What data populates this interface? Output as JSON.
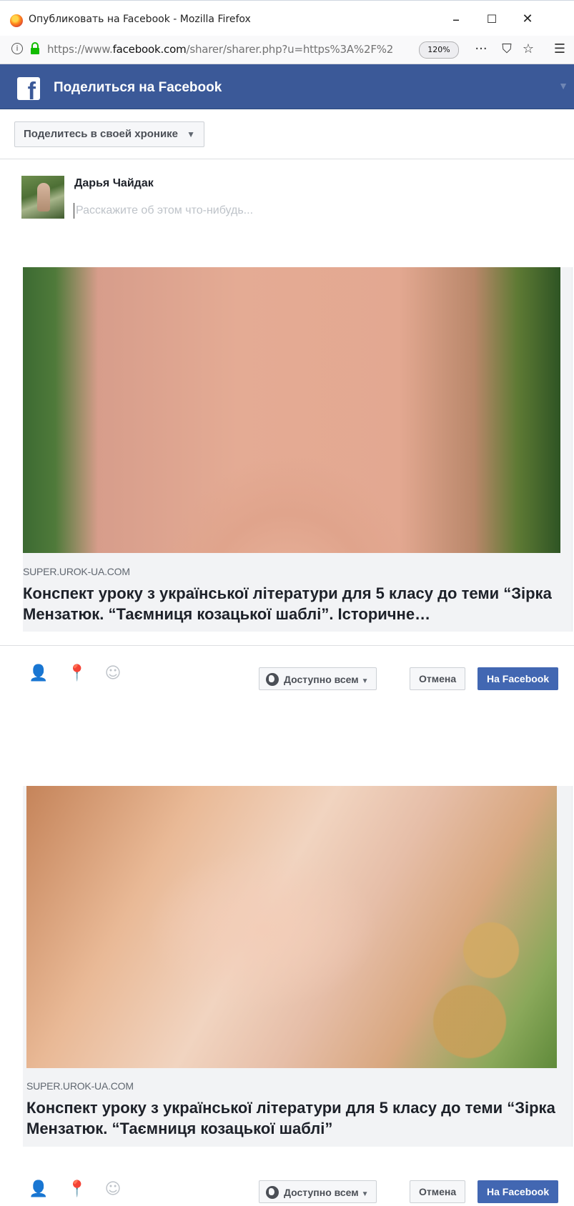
{
  "window": {
    "title": "Опубликовать на Facebook - Mozilla Firefox",
    "minimize": "–",
    "maximize": "☐",
    "close": "✕"
  },
  "addressbar": {
    "url_prefix": "https://www.",
    "url_domain": "facebook.com",
    "url_rest": "/sharer/sharer.php?u=https%3A%2F%2",
    "zoom": "120%",
    "more": "···",
    "pocket": "⛉",
    "star": "☆",
    "menu": "☰"
  },
  "fb_header": {
    "title": "Поделиться на Facebook",
    "logo": "f"
  },
  "share_target": {
    "label": "Поделитесь в своей хронике",
    "caret": "▼"
  },
  "composer": {
    "user_name": "Дарья Чайдак",
    "placeholder": "Расскажите об этом что-нибудь..."
  },
  "previews": [
    {
      "domain": "SUPER.UROK-UA.COM",
      "title": "Конспект уроку з української літератури для 5 класу до теми “Зірка Мензатюк. “Таємниця козацької шаблі”. Історичне…"
    },
    {
      "domain": "SUPER.UROK-UA.COM",
      "title": "Конспект уроку з української літератури для 5 класу до теми “Зірка Мензатюк. “Таємниця козацької шаблі”"
    }
  ],
  "actions": {
    "tag_icon": "👤",
    "location_icon": "📍",
    "feeling_icon": "☺",
    "audience": "Доступно всем",
    "audience_caret": "▼",
    "cancel": "Отмена",
    "post": "На Facebook"
  }
}
